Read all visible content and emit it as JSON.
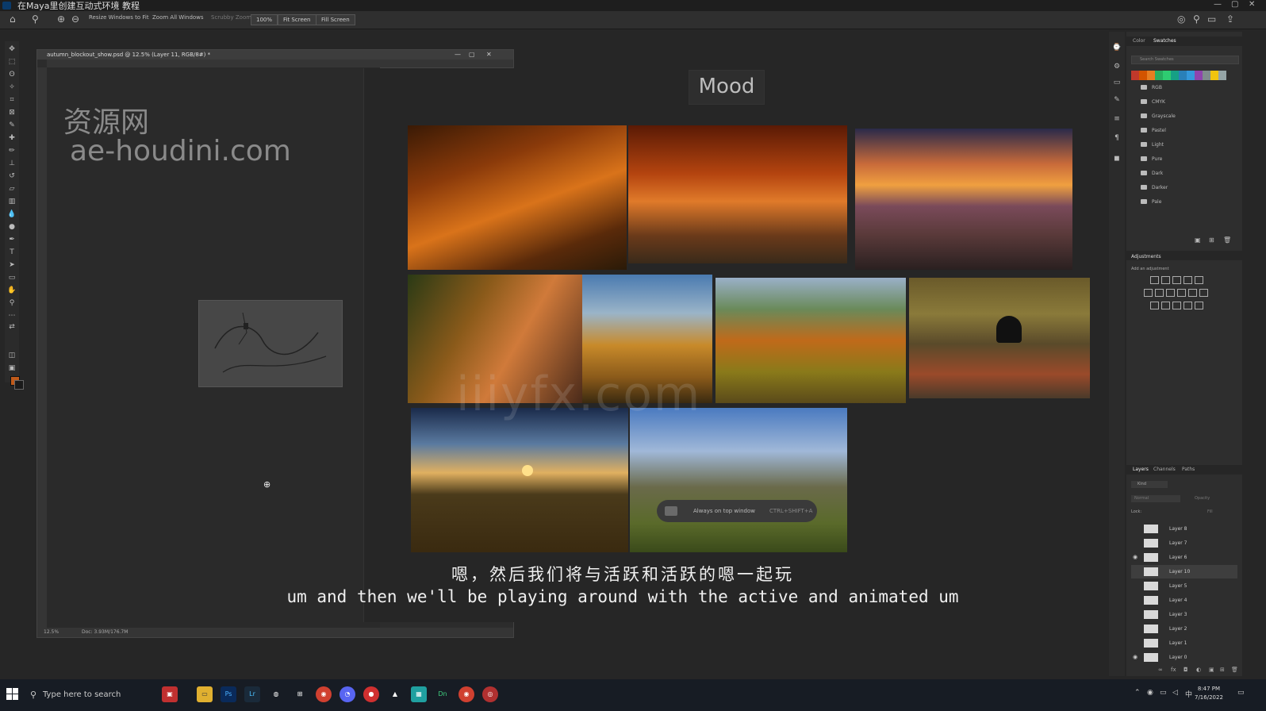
{
  "app": {
    "title": "在Maya里创建互动式环境 教程",
    "doc_tab": "autumn_blockout_show.psd @ 12.5% (Layer 11, RGB/8#) *",
    "status_zoom": "12.5%",
    "status_doc": "Doc: 3.93M/176.7M"
  },
  "options_bar": {
    "resize_windows": "Resize Windows to Fit",
    "zoom_all": "Zoom All Windows",
    "scrubby": "Scrubby Zoom",
    "zoom_100": "100%",
    "fit_screen": "Fit Screen",
    "fill_screen": "Fill Screen"
  },
  "canvas": {
    "watermark_cn": "资源网",
    "watermark_url": "ae-houdini.com",
    "board_title": "Mood",
    "big_watermark": "iiiyfx.com",
    "tooltip_text": "Always on top window",
    "tooltip_shortcut": "CTRL+SHIFT+A"
  },
  "subtitles": {
    "zh": "嗯，然后我们将与活跃和活跃的嗯一起玩",
    "en": "um and then we'll be playing around with the active and animated um"
  },
  "swatches_panel": {
    "tab_color": "Color",
    "tab_swatches": "Swatches",
    "search_placeholder": "Search Swatches",
    "colors": [
      "#c0392b",
      "#d35400",
      "#e67e22",
      "#27ae60",
      "#2ecc71",
      "#16a085",
      "#2980b9",
      "#3498db",
      "#8e44ad",
      "#7f8c8d",
      "#f1c40f",
      "#95a5a6"
    ],
    "folders": [
      "RGB",
      "CMYK",
      "Grayscale",
      "Pastel",
      "Light",
      "Pure",
      "Dark",
      "Darker",
      "Pale"
    ]
  },
  "adjustments_panel": {
    "title": "Adjustments",
    "subtitle": "Add an adjustment"
  },
  "layers_panel": {
    "tab_layers": "Layers",
    "tab_channels": "Channels",
    "tab_paths": "Paths",
    "filter_kind": "Kind",
    "blend_mode": "Normal",
    "opacity": "Opacity",
    "lock_label": "Lock:",
    "fill": "Fill",
    "layers": [
      "Layer 8",
      "Layer 7",
      "Layer 6",
      "Layer 10",
      "Layer 5",
      "Layer 4",
      "Layer 3",
      "Layer 2",
      "Layer 1",
      "Layer 0"
    ]
  },
  "taskbar": {
    "search_placeholder": "Type here to search",
    "time": "8:47 PM",
    "date": "7/16/2022"
  }
}
